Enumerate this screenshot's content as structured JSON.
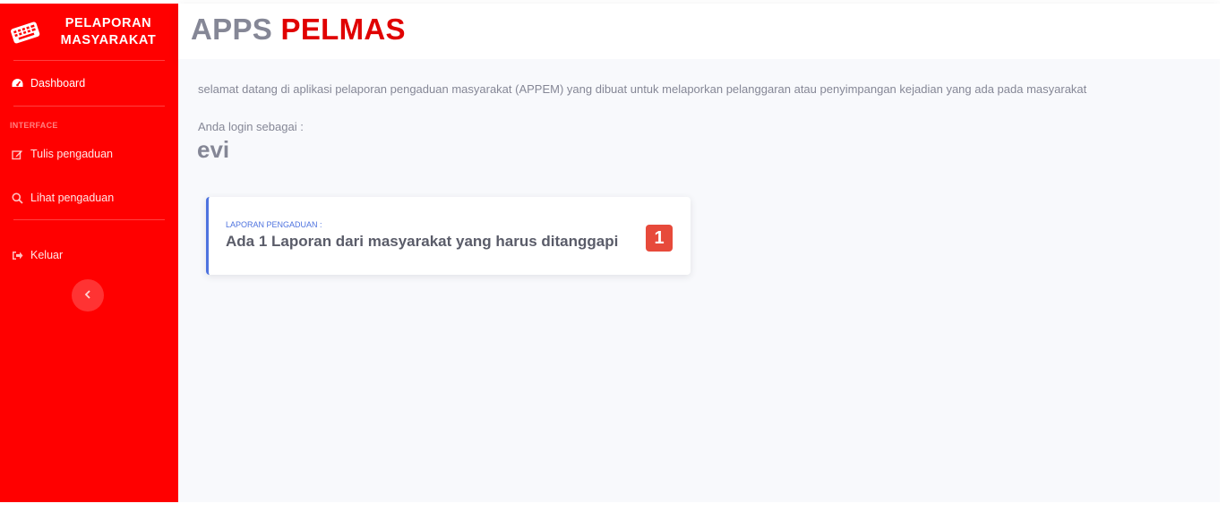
{
  "sidebar": {
    "brand": {
      "line1": "PELAPORAN",
      "line2": "MASYARAKAT",
      "icon": "keyboard-icon"
    },
    "items": [
      {
        "label": "Dashboard",
        "icon": "tachometer-icon",
        "active": true
      },
      {
        "label": "Tulis pengaduan",
        "icon": "edit-icon"
      },
      {
        "label": "Lihat pengaduan",
        "icon": "search-icon"
      },
      {
        "label": "Keluar",
        "icon": "sign-out-icon"
      }
    ],
    "heading": "INTERFACE",
    "toggle_icon": "chevron-left-icon"
  },
  "topbar": {
    "title_part1": "APPS",
    "title_part2": "PELMAS"
  },
  "main": {
    "welcome": "selamat datang di aplikasi pelaporan pengaduan masyarakat (APPEM) yang dibuat untuk melaporkan pelanggaran atau penyimpangan kejadian yang ada pada masyarakat",
    "login_label": "Anda login sebagai :",
    "username": "evi",
    "card": {
      "label": "LAPORAN PENGADUAN :",
      "text": "Ada 1 Laporan dari masyarakat yang harus ditanggapi",
      "count": "1"
    }
  },
  "colors": {
    "sidebar_bg": "#ff0000",
    "title_gray": "#858796",
    "title_red": "#e00000",
    "card_accent": "#4e73df",
    "badge": "#e74a3b"
  }
}
